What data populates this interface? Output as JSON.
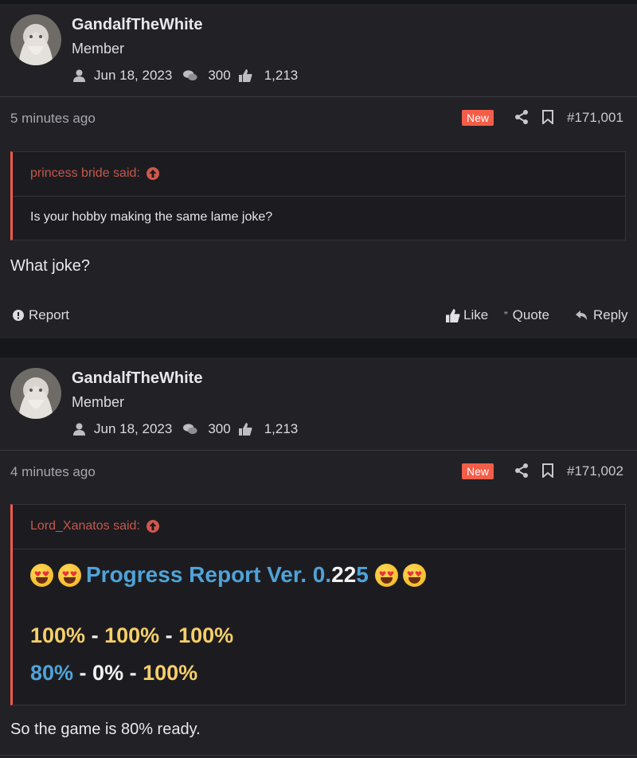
{
  "posts": [
    {
      "author": "GandalfTheWhite",
      "role": "Member",
      "joined": "Jun 18, 2023",
      "messages": "300",
      "reactions": "1,213",
      "time": "5 minutes ago",
      "badge": "New",
      "post_number": "#171,001",
      "quote": {
        "author": "princess bride said:",
        "text": "Is your hobby making the same lame joke?"
      },
      "body": "What joke?",
      "actions": {
        "report": "Report",
        "like": "Like",
        "quote": "Quote",
        "reply": "Reply"
      }
    },
    {
      "author": "GandalfTheWhite",
      "role": "Member",
      "joined": "Jun 18, 2023",
      "messages": "300",
      "reactions": "1,213",
      "time": "4 minutes ago",
      "badge": "New",
      "post_number": "#171,002",
      "quote": {
        "author": "Lord_Xanatos said:",
        "title_a": "Progress Report Ver. 0.",
        "title_b": "22",
        "title_c": "5",
        "line1_a": "100%",
        "line1_sep1": " - ",
        "line1_b": "100%",
        "line1_sep2": " - ",
        "line1_c": "100%",
        "line2_a": "80%",
        "line2_sep1": " - ",
        "line2_b": "0%",
        "line2_sep2": " - ",
        "line2_c": "100%"
      },
      "body": "So the game is 80% ready."
    }
  ],
  "colors": {
    "accent": "#f25a4a",
    "badge": "#f45d48",
    "blue": "#4fa3d8",
    "yellow": "#f6cf6a",
    "background": "#212126"
  },
  "icons": [
    "user-icon",
    "comments-icon",
    "thumbs-up-icon",
    "share-icon",
    "bookmark-icon",
    "arrow-up-circle-icon",
    "alert-circle-icon",
    "quote-marks-icon",
    "reply-icon",
    "heart-eyes-emoji"
  ]
}
